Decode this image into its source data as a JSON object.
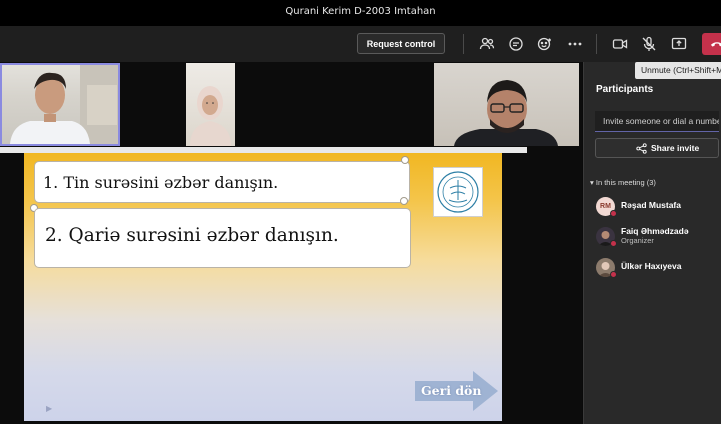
{
  "window": {
    "title": "Qurani Kerim D-2003 Imtahan"
  },
  "toolbar": {
    "request_control": "Request control",
    "icons": [
      "people-icon",
      "chat-icon",
      "reactions-icon",
      "more-icon",
      "camera-icon",
      "mic-off-icon",
      "share-tray-icon",
      "hang-up-icon"
    ]
  },
  "tooltip": {
    "text": "Unmute (Ctrl+Shift+M)"
  },
  "slide": {
    "line1": "1. Tin surəsini əzbər danışın.",
    "line2": "2. Qariə surəsini əzbər danışın.",
    "back_button": "Geri dön"
  },
  "panel": {
    "title": "Participants",
    "invite_placeholder": "Invite someone or dial a number",
    "share_invite": "Share invite",
    "section_label": "In this meeting (3)",
    "participants": [
      {
        "initials": "RM",
        "name": "Rəşad Mustafa",
        "role": ""
      },
      {
        "initials": "",
        "name": "Faiq Əhmədzadə",
        "role": "Organizer"
      },
      {
        "initials": "",
        "name": "Ülkər Haxıyeva",
        "role": ""
      }
    ]
  },
  "colors": {
    "accent": "#6264a7",
    "hangup": "#c4314b",
    "slide_top": "#f1b722",
    "slide_bottom": "#cdd3ea",
    "panel_bg": "#292929"
  }
}
